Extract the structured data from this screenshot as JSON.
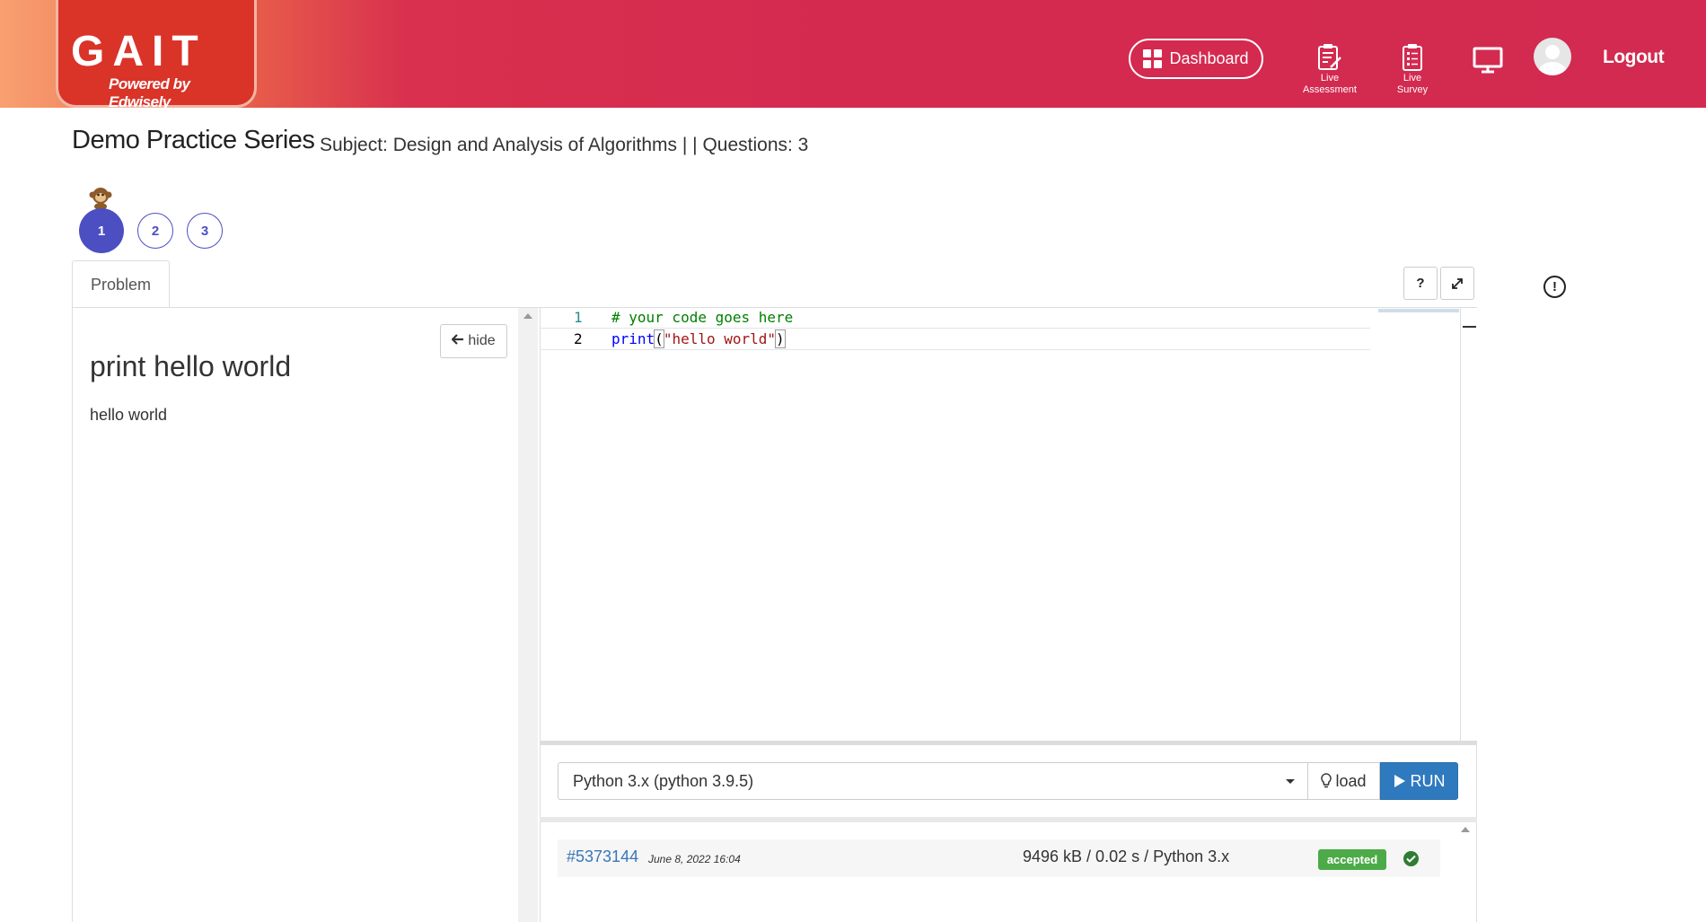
{
  "header": {
    "logo_main": "GAIT",
    "logo_sub": "Powered by Edwisely",
    "dashboard_label": "Dashboard",
    "live_assessment_label_1": "Live",
    "live_assessment_label_2": "Assessment",
    "live_survey_label_1": "Live",
    "live_survey_label_2": "Survey",
    "logout_label": "Logout",
    "colors": {
      "gradient_start": "#f8a070",
      "gradient_end": "#d22a50",
      "logo_bg": "#da3328"
    }
  },
  "page": {
    "title": "Demo Practice Series",
    "subtitle": "Subject: Design and Analysis of Algorithms | | Questions: 3"
  },
  "questions": [
    {
      "label": "1",
      "active": true
    },
    {
      "label": "2",
      "active": false
    },
    {
      "label": "3",
      "active": false
    }
  ],
  "problem": {
    "tab_label": "Problem",
    "hide_label": "hide",
    "title": "print hello world",
    "text": "hello world"
  },
  "toolbar": {
    "help_label": "?"
  },
  "editor": {
    "lines": [
      {
        "number": "1",
        "comment": "# your code goes here"
      },
      {
        "number": "2",
        "keyword": "print",
        "open": "(",
        "string": "\"hello world\"",
        "close": ")"
      }
    ]
  },
  "run": {
    "language": "Python 3.x (python 3.9.5)",
    "load_label": "load",
    "run_label": "RUN",
    "accent": "#2f7abf"
  },
  "submission": {
    "id": "#5373144",
    "date": "June 8, 2022 16:04",
    "stats": "9496 kB / 0.02 s / Python 3.x",
    "status": "accepted",
    "status_color": "#4cab48"
  }
}
